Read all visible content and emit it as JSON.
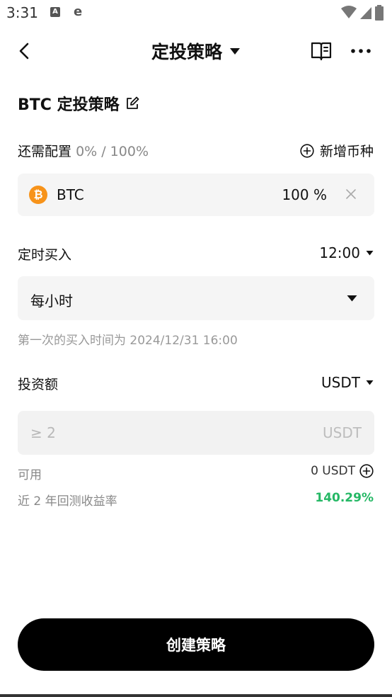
{
  "status_bar": {
    "time": "3:31",
    "icon_a": "A",
    "icon_e": "e"
  },
  "header": {
    "title": "定投策略"
  },
  "strategy": {
    "name": "BTC 定投策略"
  },
  "allocation": {
    "label": "还需配置",
    "progress": "0% / 100%",
    "add_coin_label": "新增币种"
  },
  "coins": [
    {
      "symbol": "BTC",
      "icon_glyph": "₿",
      "percent": "100 %",
      "color": "#f7931a"
    }
  ],
  "schedule": {
    "label": "定时买入",
    "time": "12:00",
    "frequency": "每小时",
    "first_buy_note": "第一次的买入时间为 2024/12/31 16:00"
  },
  "investment": {
    "label": "投资额",
    "currency": "USDT",
    "placeholder": "≥ 2",
    "unit": "USDT",
    "available_label": "可用",
    "available_value": "0 USDT",
    "backtest_label": "近 2 年回测收益率",
    "backtest_value": "140.29%"
  },
  "actions": {
    "create_label": "创建策略"
  },
  "colors": {
    "accent_green": "#25b865",
    "button_bg": "#000000",
    "btc_orange": "#f7931a"
  }
}
